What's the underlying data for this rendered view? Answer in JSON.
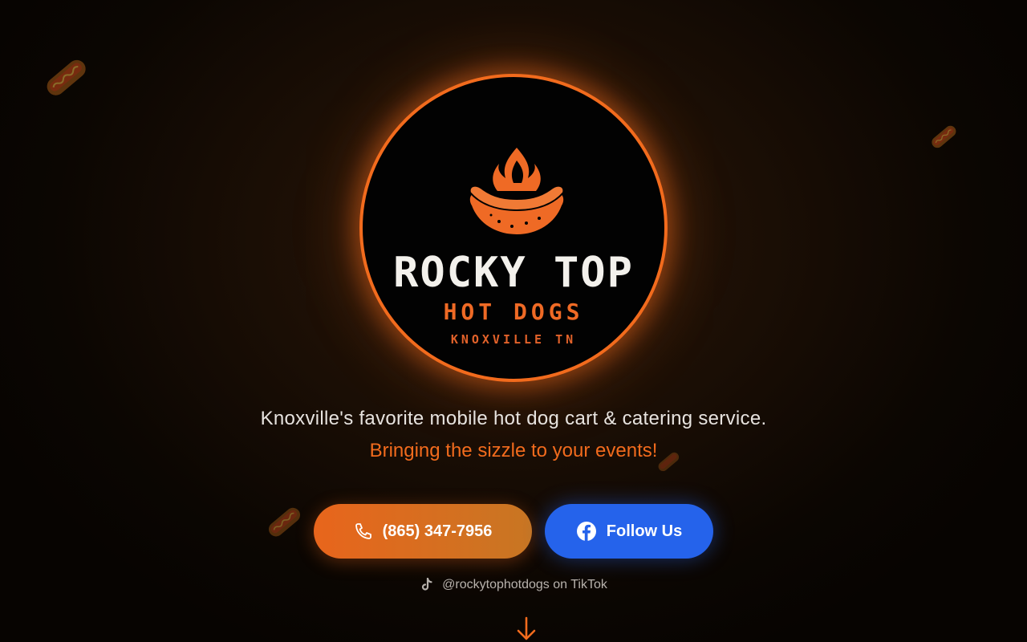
{
  "logo": {
    "title": "ROCKY TOP",
    "subtitle": "HOT DOGS",
    "location": "KNOXVILLE TN"
  },
  "tagline": "Knoxville's favorite mobile hot dog cart & catering service.",
  "subtagline": "Bringing the sizzle to your events!",
  "buttons": {
    "phone": {
      "label": "(865) 347-7956",
      "icon": "phone-icon"
    },
    "facebook": {
      "label": "Follow Us",
      "icon": "facebook-icon"
    }
  },
  "tiktok": {
    "label": "@rockytophotdogs on TikTok",
    "icon": "tiktok-icon"
  },
  "scroll": {
    "icon": "arrow-down-icon"
  },
  "colors": {
    "accent": "#f26b1d",
    "facebook": "#2563eb",
    "background": "#1a0e05"
  }
}
